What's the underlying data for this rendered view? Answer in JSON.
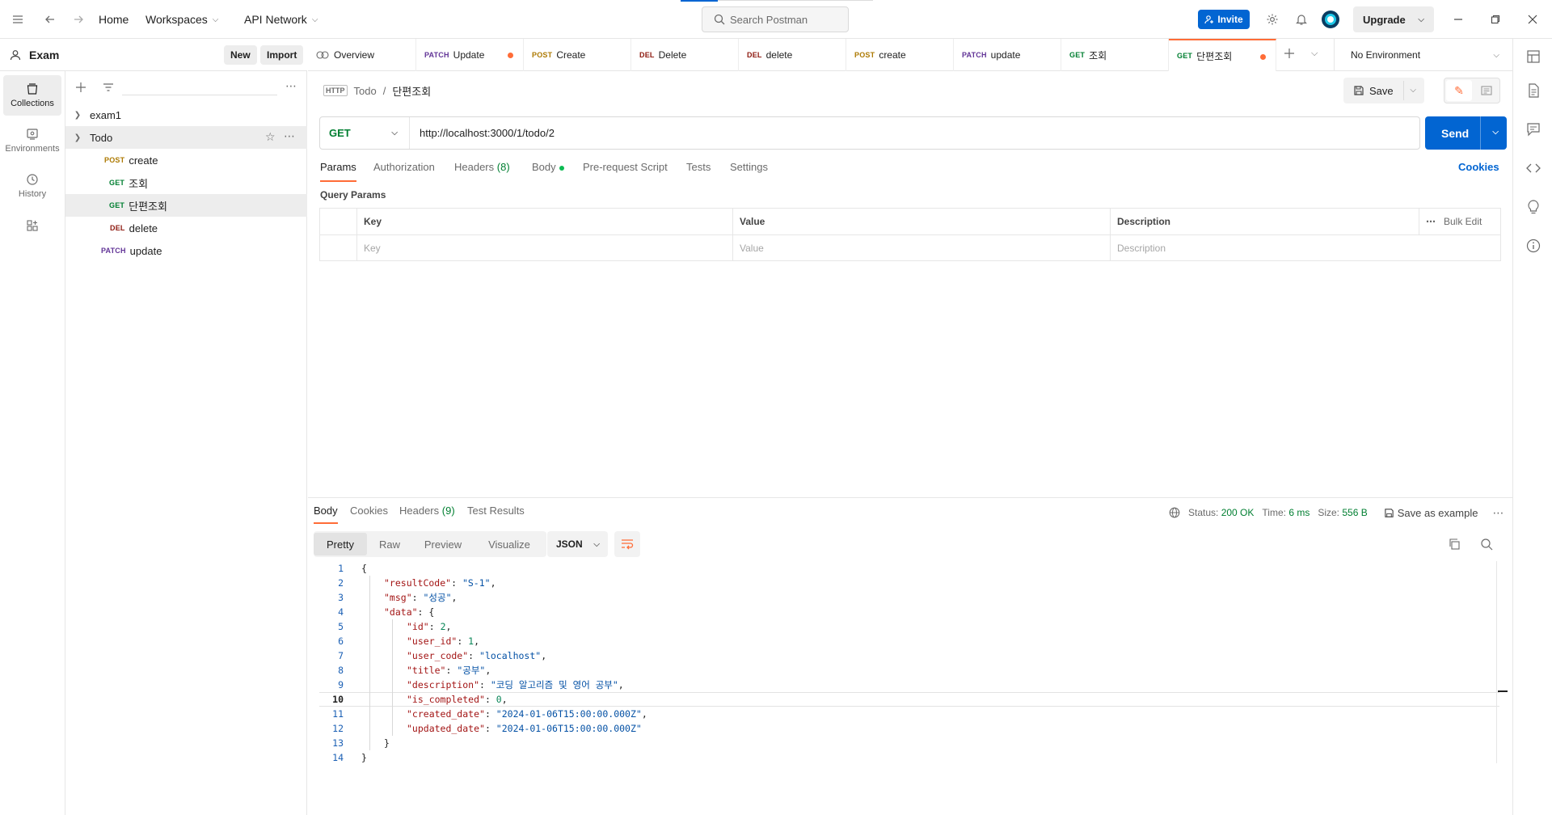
{
  "topbar": {
    "home": "Home",
    "workspaces": "Workspaces",
    "api_network": "API Network",
    "search_placeholder": "Search Postman",
    "invite": "Invite",
    "upgrade": "Upgrade"
  },
  "workspace": {
    "name": "Exam",
    "new_label": "New",
    "import_label": "Import"
  },
  "rail": {
    "items": [
      {
        "label": "Collections",
        "icon": "collections-icon"
      },
      {
        "label": "Environments",
        "icon": "environments-icon"
      },
      {
        "label": "History",
        "icon": "history-icon"
      },
      {
        "label": "",
        "icon": "apps-icon"
      }
    ]
  },
  "tree": {
    "collections": [
      {
        "name": "exam1"
      },
      {
        "name": "Todo"
      }
    ],
    "requests": [
      {
        "method": "POST",
        "name": "create"
      },
      {
        "method": "GET",
        "name": "조회"
      },
      {
        "method": "GET",
        "name": "단편조회"
      },
      {
        "method": "DEL",
        "name": "delete"
      },
      {
        "method": "PATCH",
        "name": "update"
      }
    ]
  },
  "tabs": [
    {
      "method": "",
      "label": "Overview"
    },
    {
      "method": "PATCH",
      "label": "Update"
    },
    {
      "method": "POST",
      "label": "Create"
    },
    {
      "method": "DEL",
      "label": "Delete"
    },
    {
      "method": "DEL",
      "label": "delete"
    },
    {
      "method": "POST",
      "label": "create"
    },
    {
      "method": "PATCH",
      "label": "update"
    },
    {
      "method": "GET",
      "label": "조회"
    },
    {
      "method": "GET",
      "label": "단편조회"
    }
  ],
  "environment": "No Environment",
  "request": {
    "breadcrumb_icon": "HTTP",
    "breadcrumb_parent": "Todo",
    "breadcrumb_sep": "/",
    "breadcrumb_current": "단편조회",
    "save_label": "Save",
    "method": "GET",
    "url": "http://localhost:3000/1/todo/2",
    "send_label": "Send",
    "subtabs": {
      "params": "Params",
      "authorization": "Authorization",
      "headers": "Headers",
      "headers_count": "(8)",
      "body": "Body",
      "prerequest": "Pre-request Script",
      "tests": "Tests",
      "settings": "Settings"
    },
    "cookies": "Cookies",
    "query_params_title": "Query Params",
    "params_table": {
      "headers": [
        "Key",
        "Value",
        "Description"
      ],
      "placeholders": [
        "Key",
        "Value",
        "Description"
      ],
      "bulk_edit": "Bulk Edit"
    }
  },
  "response": {
    "tabs": {
      "body": "Body",
      "cookies": "Cookies",
      "headers": "Headers",
      "headers_count": "(9)",
      "test_results": "Test Results"
    },
    "status_label": "Status:",
    "status_value": "200 OK",
    "time_label": "Time:",
    "time_value": "6 ms",
    "size_label": "Size:",
    "size_value": "556 B",
    "save_example": "Save as example",
    "views": [
      "Pretty",
      "Raw",
      "Preview",
      "Visualize"
    ],
    "format": "JSON",
    "current_line": 10,
    "lines": [
      {
        "n": "1",
        "indent": 0,
        "key": "",
        "value": "",
        "vtype": "",
        "text": "{"
      },
      {
        "n": "2",
        "indent": 1,
        "key": "\"resultCode\"",
        "value": "\"S-1\"",
        "vtype": "str",
        "text": ","
      },
      {
        "n": "3",
        "indent": 1,
        "key": "\"msg\"",
        "value": "\"성공\"",
        "vtype": "str",
        "text": ","
      },
      {
        "n": "4",
        "indent": 1,
        "key": "\"data\"",
        "value": "",
        "vtype": "",
        "text": "{"
      },
      {
        "n": "5",
        "indent": 2,
        "key": "\"id\"",
        "value": "2",
        "vtype": "num",
        "text": ","
      },
      {
        "n": "6",
        "indent": 2,
        "key": "\"user_id\"",
        "value": "1",
        "vtype": "num",
        "text": ","
      },
      {
        "n": "7",
        "indent": 2,
        "key": "\"user_code\"",
        "value": "\"localhost\"",
        "vtype": "str",
        "text": ","
      },
      {
        "n": "8",
        "indent": 2,
        "key": "\"title\"",
        "value": "\"공부\"",
        "vtype": "str",
        "text": ","
      },
      {
        "n": "9",
        "indent": 2,
        "key": "\"description\"",
        "value": "\"코딩 알고리즘 및 영어 공부\"",
        "vtype": "str",
        "text": ","
      },
      {
        "n": "10",
        "indent": 2,
        "key": "\"is_completed\"",
        "value": "0",
        "vtype": "num",
        "text": ","
      },
      {
        "n": "11",
        "indent": 2,
        "key": "\"created_date\"",
        "value": "\"2024-01-06T15:00:00.000Z\"",
        "vtype": "str",
        "text": ","
      },
      {
        "n": "12",
        "indent": 2,
        "key": "\"updated_date\"",
        "value": "\"2024-01-06T15:00:00.000Z\"",
        "vtype": "str",
        "text": ""
      },
      {
        "n": "13",
        "indent": 1,
        "key": "",
        "value": "",
        "vtype": "",
        "text": "}"
      },
      {
        "n": "14",
        "indent": 0,
        "key": "",
        "value": "",
        "vtype": "",
        "text": "}"
      }
    ]
  },
  "colors": {
    "accent": "#ff6c37",
    "primary": "#0265d2",
    "get": "#007f31",
    "post": "#ad7a03",
    "del": "#8e1a10",
    "patch": "#623497"
  }
}
